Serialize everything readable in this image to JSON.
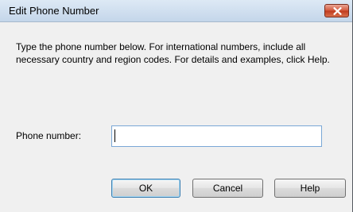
{
  "window": {
    "title": "Edit Phone Number"
  },
  "dialog": {
    "instructions": "Type the phone number below. For international numbers, include all necessary country and region codes. For details and examples, click Help.",
    "phone_label": "Phone number:",
    "phone_value": ""
  },
  "buttons": {
    "ok_label": "OK",
    "cancel_label": "Cancel",
    "help_label": "Help"
  },
  "icons": {
    "close": "close-icon"
  },
  "colors": {
    "titlebar": "#c4d6ea",
    "close_button": "#c8452a",
    "dialog_background": "#f0f0f0",
    "default_button_border": "#3c7fb1"
  }
}
